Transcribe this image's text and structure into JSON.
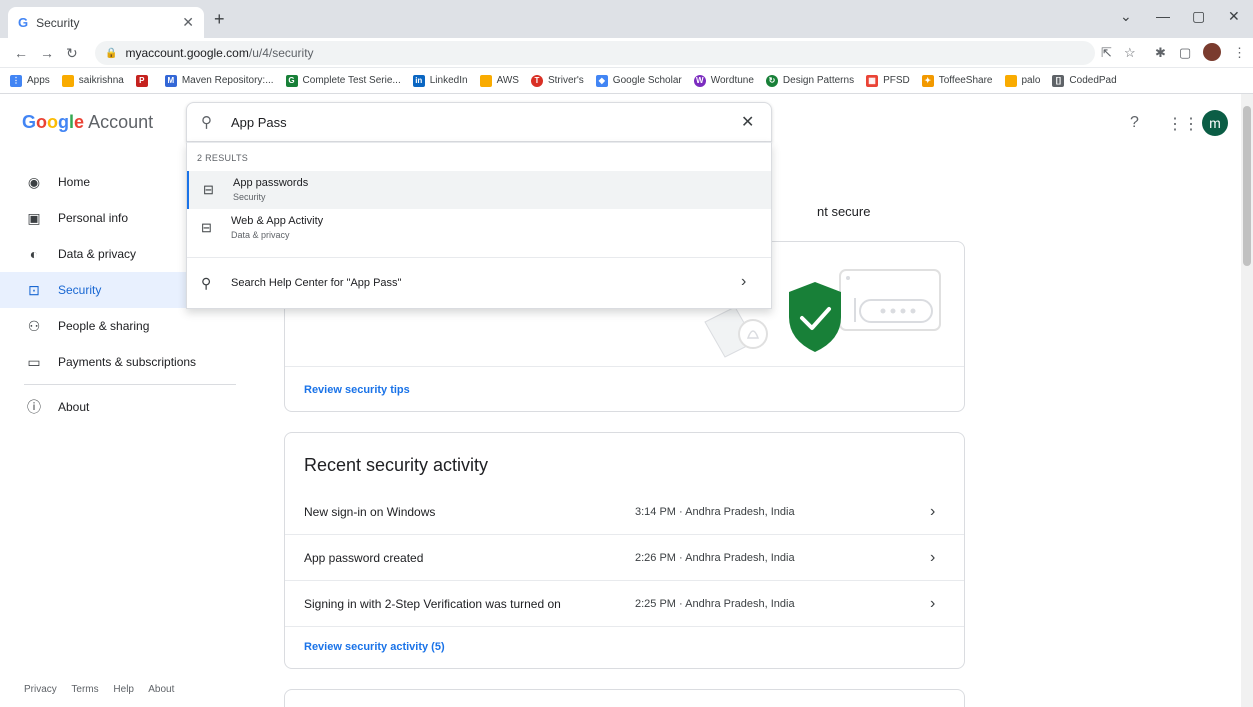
{
  "browser": {
    "tab_title": "Security",
    "tab_favicon": "G",
    "url_host": "myaccount.google.com",
    "url_path": "/u/4/security",
    "bookmarks": [
      {
        "label": "Apps",
        "color": "#4285f4",
        "glyph": "⋮⋮"
      },
      {
        "label": "saikrishna",
        "color": "#f9ab00",
        "glyph": ""
      },
      {
        "label": "",
        "color": "#c5221f",
        "glyph": "P"
      },
      {
        "label": "Maven Repository:...",
        "color": "#3367d6",
        "glyph": "M"
      },
      {
        "label": "Complete Test Serie...",
        "color": "#188038",
        "glyph": "G"
      },
      {
        "label": "LinkedIn",
        "color": "#0a66c2",
        "glyph": "in"
      },
      {
        "label": "AWS",
        "color": "#f9ab00",
        "glyph": ""
      },
      {
        "label": "Striver's",
        "color": "#d93025",
        "glyph": "T"
      },
      {
        "label": "Google Scholar",
        "color": "#4285f4",
        "glyph": "◆"
      },
      {
        "label": "Wordtune",
        "color": "#7b2cbf",
        "glyph": "W"
      },
      {
        "label": "Design Patterns",
        "color": "#188038",
        "glyph": "↻"
      },
      {
        "label": "PFSD",
        "color": "#ea4335",
        "glyph": "▦"
      },
      {
        "label": "ToffeeShare",
        "color": "#f29900",
        "glyph": "✦"
      },
      {
        "label": "palo",
        "color": "#f9ab00",
        "glyph": ""
      },
      {
        "label": "CodedPad",
        "color": "#5f6368",
        "glyph": "[]"
      }
    ]
  },
  "header": {
    "logo_google": "Google",
    "logo_account": "Account",
    "avatar_letter": "m"
  },
  "sidebar": {
    "items": [
      {
        "label": "Home",
        "icon": "◉"
      },
      {
        "label": "Personal info",
        "icon": "▣"
      },
      {
        "label": "Data & privacy",
        "icon": "◐"
      },
      {
        "label": "Security",
        "icon": "🔒"
      },
      {
        "label": "People & sharing",
        "icon": "⚇"
      },
      {
        "label": "Payments & subscriptions",
        "icon": "▭"
      }
    ],
    "about": {
      "label": "About",
      "icon": "ⓘ"
    }
  },
  "footer": {
    "privacy": "Privacy",
    "terms": "Terms",
    "help": "Help",
    "about": "About"
  },
  "search": {
    "query": "App Pass",
    "results_count": "2 RESULTS",
    "results": [
      {
        "title": "App passwords",
        "section": "Security"
      },
      {
        "title": "Web & App Activity",
        "section": "Data & privacy"
      }
    ],
    "help_text": "Search Help Center for \"App Pass\""
  },
  "security_card": {
    "partial_text": "nt secure",
    "link": "Review security tips"
  },
  "recent_activity": {
    "title": "Recent security activity",
    "rows": [
      {
        "event": "New sign-in on Windows",
        "when": "3:14 PM · Andhra Pradesh, India"
      },
      {
        "event": "App password created",
        "when": "2:26 PM · Andhra Pradesh, India"
      },
      {
        "event": "Signing in with 2-Step Verification was turned on",
        "when": "2:25 PM · Andhra Pradesh, India"
      }
    ],
    "link": "Review security activity (5)"
  },
  "colors": {
    "accent": "#1a73e8",
    "shield": "#188038",
    "avatar": "#0b5d45"
  }
}
